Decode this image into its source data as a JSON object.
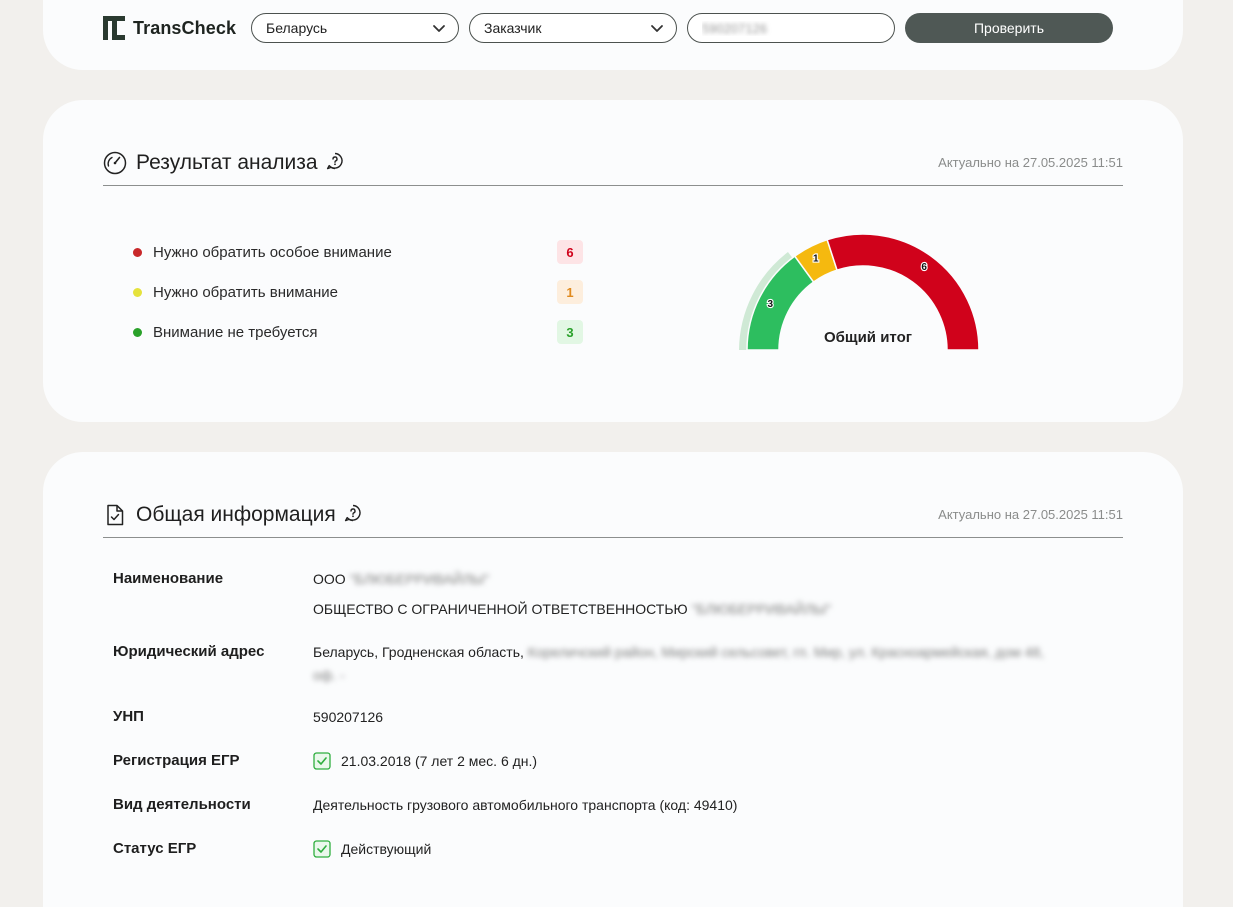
{
  "topbar": {
    "logo_text": "TransCheck",
    "country_select": {
      "value": "Беларусь"
    },
    "role_select": {
      "value": "Заказчик"
    },
    "unp_input": {
      "value": "590207126"
    },
    "check_button_label": "Проверить"
  },
  "result": {
    "title": "Результат анализа",
    "date": "Актуально на 27.05.2025 11:51",
    "legend": [
      {
        "label": "Нужно обратить особое внимание",
        "count": "6",
        "color": "#c8282a",
        "badge_bg": "#fde4e6",
        "badge_fg": "#d0021b"
      },
      {
        "label": "Нужно обратить внимание",
        "count": "1",
        "color": "#e5e23c",
        "badge_bg": "#fdeedd",
        "badge_fg": "#e08a1e"
      },
      {
        "label": "Внимание не требуется",
        "count": "3",
        "color": "#2aa12a",
        "badge_bg": "#e2f7e4",
        "badge_fg": "#2aa12a"
      }
    ],
    "gauge": {
      "center_label": "Общий итог",
      "segments": [
        {
          "name": "green",
          "value": 3,
          "color": "#2dbe5f"
        },
        {
          "name": "yellow",
          "value": 1,
          "color": "#f5b90f"
        },
        {
          "name": "red",
          "value": 6,
          "color": "#d0021b"
        }
      ]
    }
  },
  "info": {
    "title": "Общая информация",
    "date": "Актуально на 27.05.2025 11:51",
    "rows": {
      "name_key": "Наименование",
      "name_short": "ООО",
      "name_short_blur": "\"БЛЮБЕРРИВАЙЛЫ\"",
      "name_full": "ОБЩЕСТВО С ОГРАНИЧЕННОЙ ОТВЕТСТВЕННОСТЬЮ",
      "name_full_blur": "\"БЛЮБЕРРИВАЙЛЫ\"",
      "address_key": "Юридический адрес",
      "address_visible": "Беларусь, Гродненская область,",
      "address_blur_1": "Кореличский район, Мирский сельсовет, гп. Мир, ул. Красноармейская, дом 48,",
      "address_blur_2": "оф. -",
      "unp_key": "УНП",
      "unp_value": "590207126",
      "reg_key": "Регистрация ЕГР",
      "reg_value": "21.03.2018 (7 лет 2 мес. 6 дн.)",
      "activity_key": "Вид деятельности",
      "activity_value": "Деятельность грузового автомобильного транспорта (код: 49410)",
      "status_key": "Статус ЕГР",
      "status_value": "Действующий"
    }
  }
}
